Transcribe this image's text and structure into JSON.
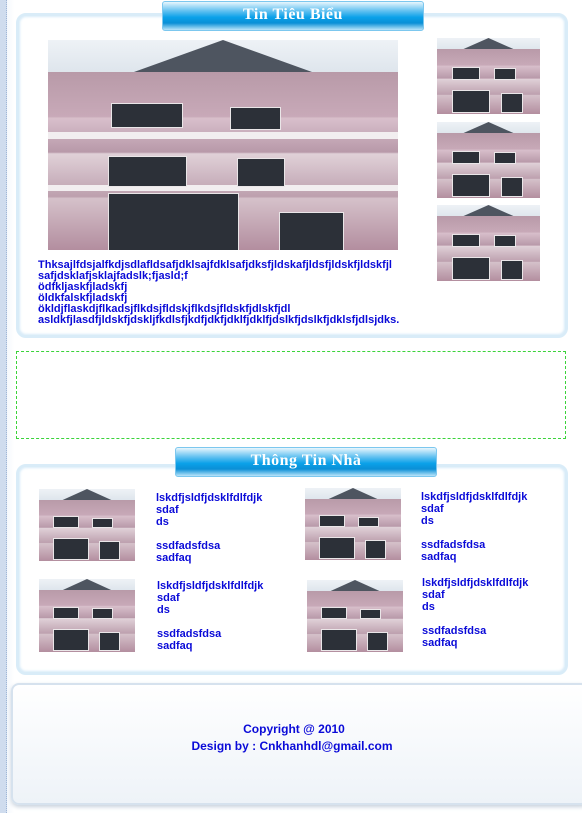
{
  "featured": {
    "title": "Tin Tiêu Biểu",
    "body": "Thksajlfdsjalfkdjsdlafldsafjdklsajfdklsafjdksfjldskafjldsfjldskfjldskfjl\nsafjdsklafjsklajfadslk;fjasld;f\nödfkljaskfjladskfj\nöldkfalskfjladskfj\nökldjflaskdjflkadsjflkdsjfldskjflkdsjfldskfjdlskfjdl\nasldkfjlasdfjldskfjdskljfkdlsfjkdfjdkfjdklfjdklfjdslkfjdslkfjdklsfjdlsjdks."
  },
  "house_info": {
    "title": "Thông Tin Nhà",
    "items": [
      {
        "text": "lskdfjsldfjdsklfdlfdjk\nsdaf\nds\n\nssdfadsfdsa\nsadfaq"
      },
      {
        "text": "lskdfjsldfjdsklfdlfdjk\nsdaf\nds\n\nssdfadsfdsa\nsadfaq"
      },
      {
        "text": "lskdfjsldfjdsklfdlfdjk\nsdaf\nds\n\nssdfadsfdsa\nsadfaq"
      },
      {
        "text": "lskdfjsldfjdsklfdlfdjk\nsdaf\nds\n\nssdfadsfdsa\nsadfaq"
      }
    ]
  },
  "footer": {
    "copyright": "Copyright @ 2010",
    "design": "Design by : Cnkhanhdl@gmail.com"
  }
}
